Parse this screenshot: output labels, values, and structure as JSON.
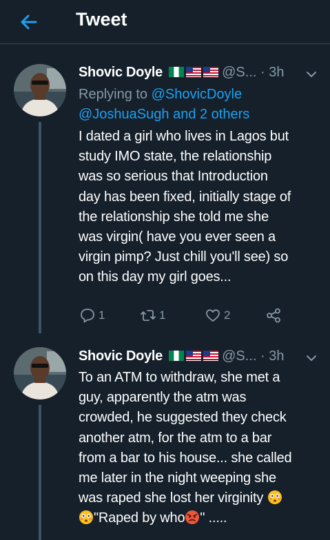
{
  "header": {
    "title": "Tweet"
  },
  "tweets": [
    {
      "name": "Shovic Doyle",
      "handle": "@S...",
      "time": "· 3h",
      "reply_prefix": "Replying to ",
      "reply_mention_1": "@ShovicDoyle",
      "reply_mention_2": "@JoshuaSugh",
      "reply_others": " and 2 others",
      "lines": [
        "I dated a girl who lives in Lagos but",
        "study  IMO state, the relationship",
        "was so serious that Introduction",
        "day has been fixed, initially stage of",
        "the relationship she told me she",
        "was virgin( have you ever seen a",
        "virgin pimp? Just chill you'll see) so",
        "on this day my girl goes..."
      ],
      "reply_count": "1",
      "retweet_count": "1",
      "like_count": "2"
    },
    {
      "name": "Shovic Doyle",
      "handle": "@S...",
      "time": "· 3h",
      "lines": [
        "To an ATM to withdraw, she met a",
        "guy, apparently the atm was",
        "crowded, he suggested they check",
        "another atm, for the atm to a bar",
        "from a bar to his house... she called",
        "me later in the night weeping she",
        "was raped she lost her virginity"
      ],
      "last_line_a": "\"Raped by who",
      "last_line_b": "\" ....."
    }
  ],
  "icons": {
    "back": "arrow-left-icon",
    "caret": "chevron-down-icon",
    "reply": "reply-bubble-icon",
    "retweet": "retweet-icon",
    "like": "heart-icon",
    "share": "share-icon",
    "emoji_flushed": "flushed-face-emoji",
    "emoji_angry": "angry-face-emoji"
  },
  "colors": {
    "background": "#15202b",
    "accent": "#1da1f2",
    "secondary_text": "#8899a6",
    "divider": "#38444d"
  }
}
